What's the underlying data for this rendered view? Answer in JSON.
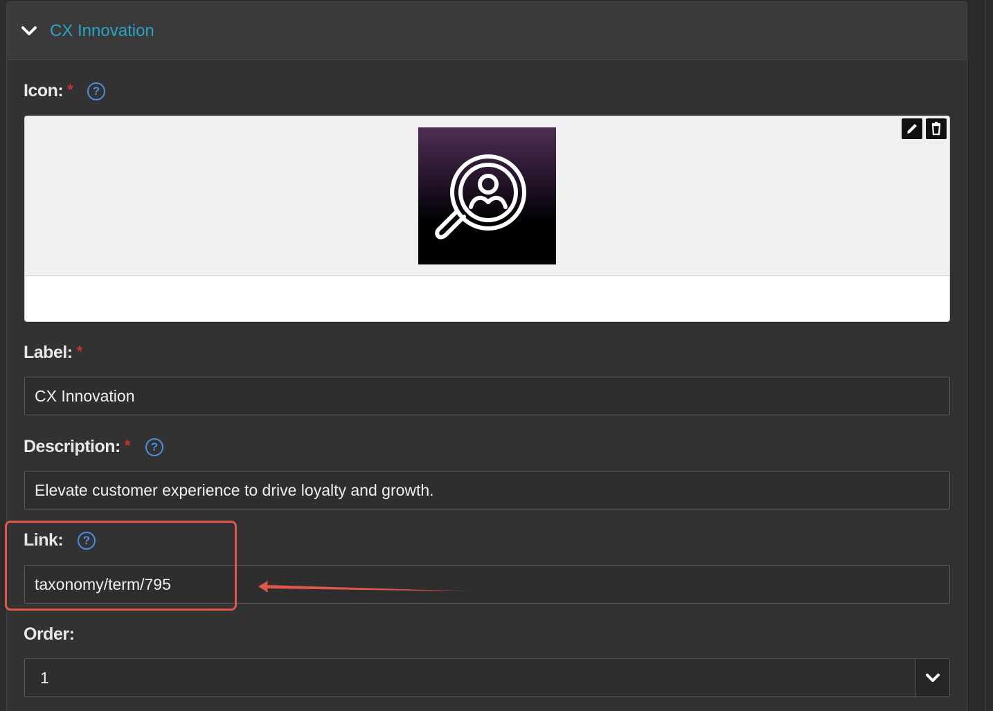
{
  "panel": {
    "title": "CX Innovation"
  },
  "fields": {
    "icon": {
      "label": "Icon:",
      "required": "*",
      "help": "?",
      "edit_icon": "pencil-icon",
      "remove_icon": "trash-icon",
      "thumbnail_icon": "magnifier-person-icon"
    },
    "label": {
      "label": "Label:",
      "required": "*",
      "value": "CX Innovation"
    },
    "description": {
      "label": "Description:",
      "required": "*",
      "help": "?",
      "value": "Elevate customer experience to drive loyalty and growth."
    },
    "link": {
      "label": "Link:",
      "help": "?",
      "value": "taxonomy/term/795"
    },
    "order": {
      "label": "Order:",
      "value": "1"
    }
  },
  "colors": {
    "accent": "#2aa4c4",
    "required": "#d0302e",
    "help": "#4c8de0",
    "annotation": "#e2574c"
  }
}
